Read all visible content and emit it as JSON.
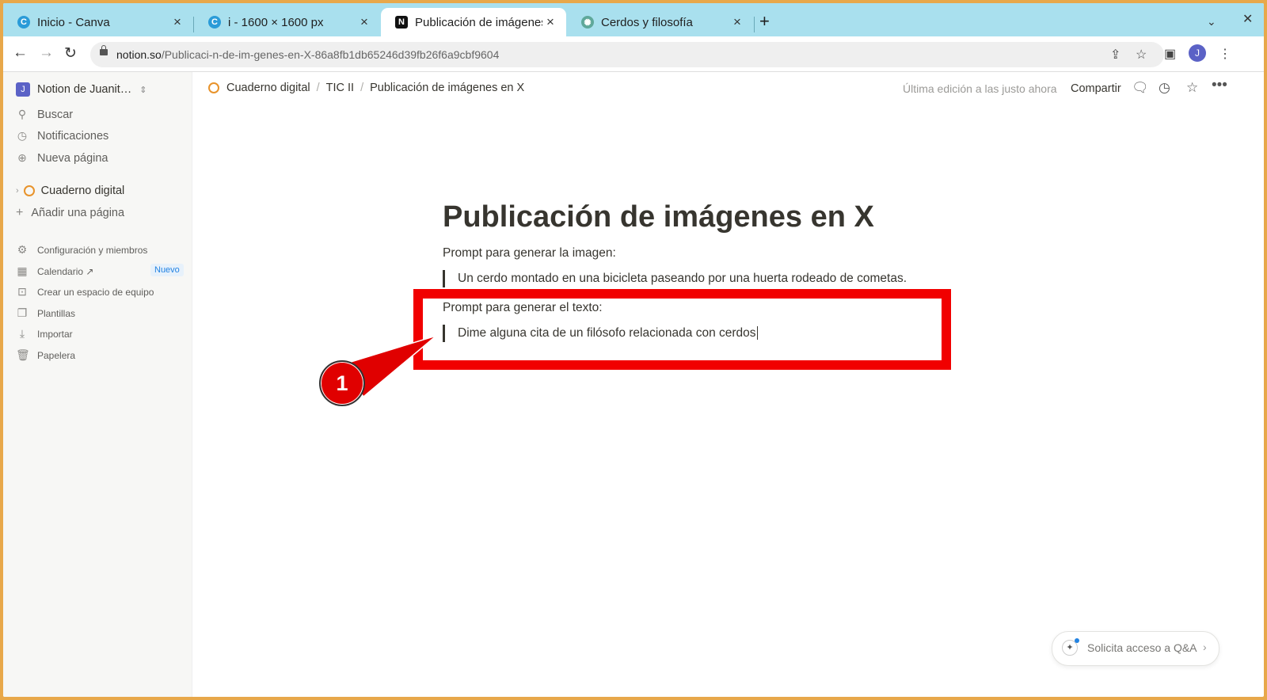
{
  "browser": {
    "tabs": [
      {
        "label": "Inicio - Canva",
        "icon": "canva-icon",
        "color": "#2a9bd8"
      },
      {
        "label": "i - 1600 × 1600 px",
        "icon": "canva-icon",
        "color": "#2a9bd8"
      },
      {
        "label": "Publicación de imágenes",
        "icon": "notion-icon",
        "color": "#111111"
      },
      {
        "label": "Cerdos y filosofía",
        "icon": "chatgpt-icon",
        "color": "#5fa89a"
      }
    ],
    "close_glyph": "×",
    "new_tab": "+",
    "url_host": "notion.so",
    "url_path": "/Publicaci-n-de-im-genes-en-X-86a8fb1db65246d39fb26f6a9cbf9604",
    "profile_initial": "J"
  },
  "sidebar": {
    "workspace": "Notion de Juanit…",
    "workspace_initial": "J",
    "top_items": [
      {
        "label": "Buscar",
        "icon": "search-icon"
      },
      {
        "label": "Notificaciones",
        "icon": "clock-icon"
      },
      {
        "label": "Nueva página",
        "icon": "plus-circle-icon"
      }
    ],
    "page_item": "Cuaderno digital",
    "add_page": "Añadir una página",
    "bottom_items": [
      {
        "label": "Configuración y miembros",
        "icon": "gear-icon"
      },
      {
        "label": "Calendario ↗",
        "icon": "calendar-icon"
      },
      {
        "label": "Crear un espacio de equipo",
        "icon": "team-icon"
      },
      {
        "label": "Plantillas",
        "icon": "templates-icon"
      },
      {
        "label": "Importar",
        "icon": "download-icon"
      },
      {
        "label": "Papelera",
        "icon": "trash-icon"
      }
    ],
    "calendar_badge": "Nuevo"
  },
  "topbar": {
    "breadcrumb": [
      "Cuaderno digital",
      "TIC II",
      "Publicación de imágenes en X"
    ],
    "separator": "/",
    "last_edit": "Última edición a las justo ahora",
    "share": "Compartir"
  },
  "page": {
    "title": "Publicación de imágenes en X",
    "label_image": "Prompt para generar la imagen:",
    "quote_image": "Un cerdo montado en una bicicleta paseando por una huerta rodeado de cometas.",
    "label_text": "Prompt para generar el texto:",
    "quote_text": "Dime alguna cita de un filósofo relacionada con cerdos"
  },
  "annotation": {
    "number": "1",
    "color": "#f10000"
  },
  "qa_button": {
    "label": "Solicita acceso a Q&A"
  }
}
